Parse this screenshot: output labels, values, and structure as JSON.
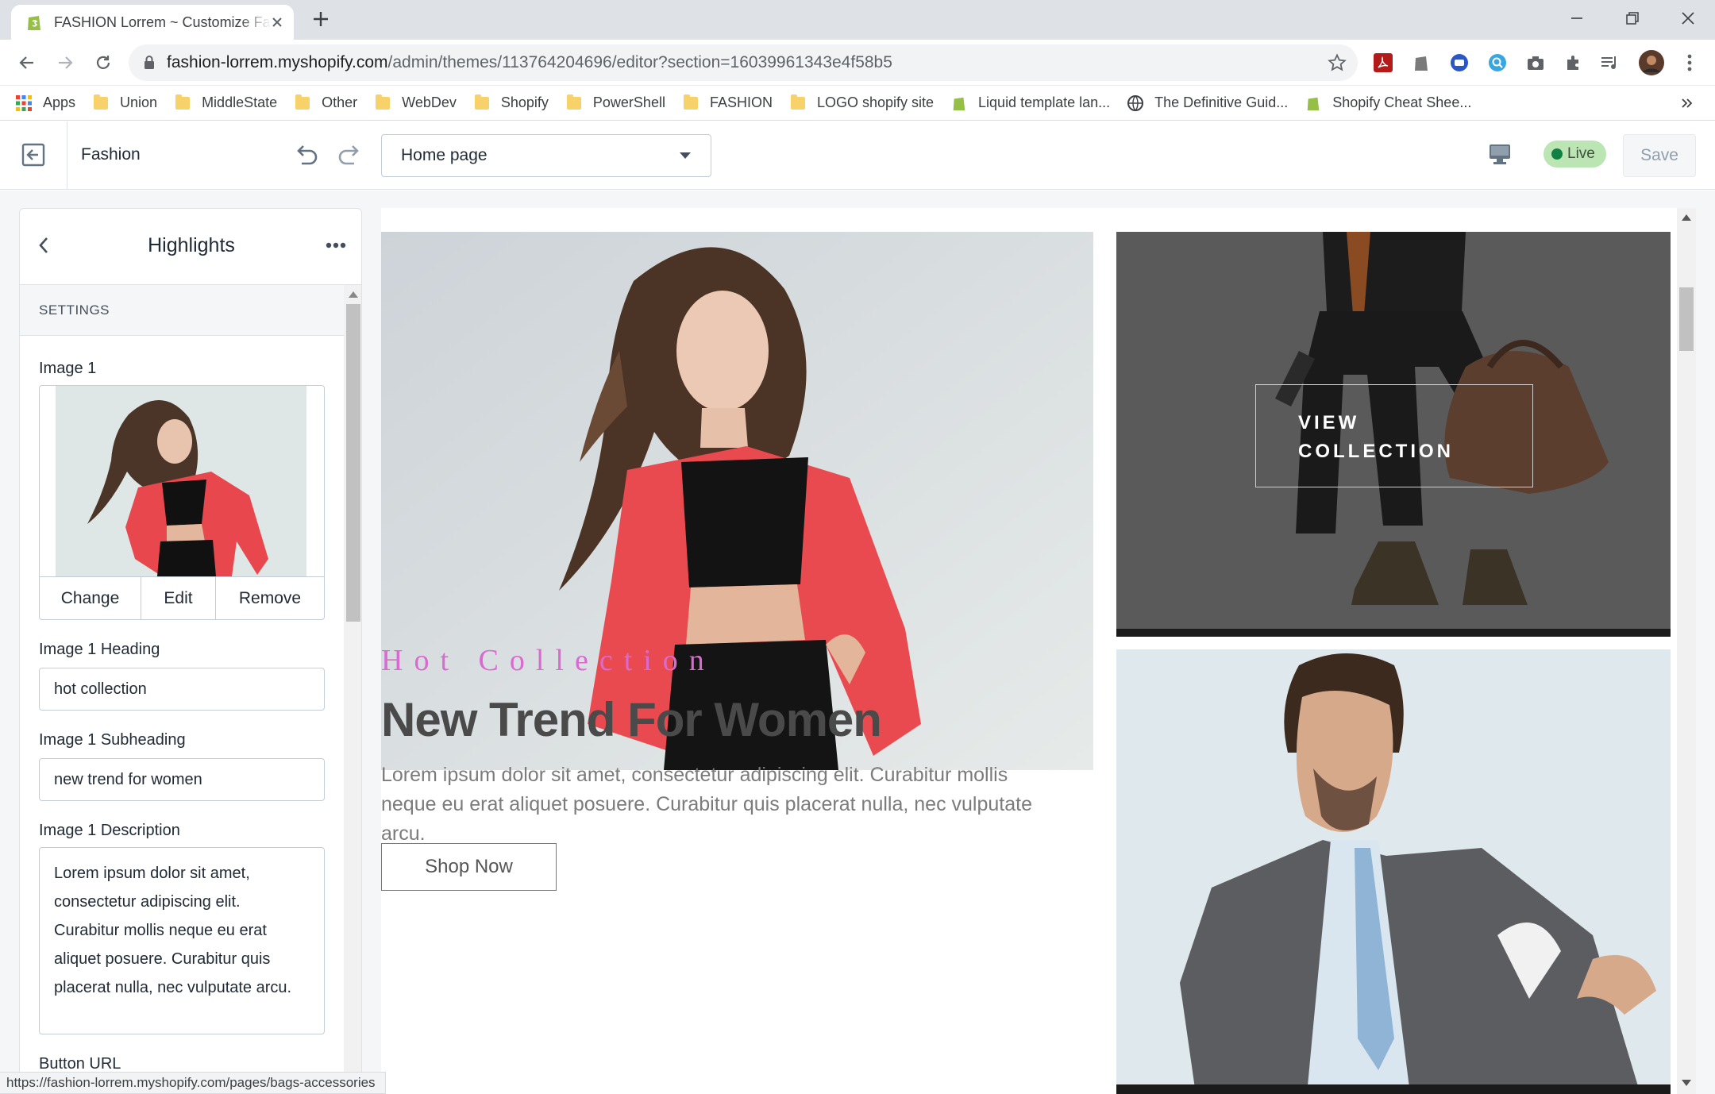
{
  "browser": {
    "tab_title": "FASHION Lorrem ~ Customize Fashion",
    "url_host": "fashion-lorrem.myshopify.com",
    "url_path": "/admin/themes/113764204696/editor?section=16039961343e4f58b5",
    "bookmarks": [
      {
        "label": "Apps",
        "icon": "apps-grid-icon"
      },
      {
        "label": "Union",
        "icon": "folder-icon"
      },
      {
        "label": "MiddleState",
        "icon": "folder-icon"
      },
      {
        "label": "Other",
        "icon": "folder-icon"
      },
      {
        "label": "WebDev",
        "icon": "folder-icon"
      },
      {
        "label": "Shopify",
        "icon": "folder-icon"
      },
      {
        "label": "PowerShell",
        "icon": "folder-icon"
      },
      {
        "label": "FASHION",
        "icon": "folder-icon"
      },
      {
        "label": "LOGO shopify site",
        "icon": "folder-icon"
      },
      {
        "label": "Liquid template lan...",
        "icon": "shopify-icon"
      },
      {
        "label": "The Definitive Guid...",
        "icon": "globe-icon"
      },
      {
        "label": "Shopify Cheat Shee...",
        "icon": "shopify-icon"
      }
    ],
    "status_url": "https://fashion-lorrem.myshopify.com/pages/bags-accessories"
  },
  "editor": {
    "theme_name": "Fashion",
    "template_select": "Home page",
    "live_label": "Live",
    "save_label": "Save"
  },
  "sidebar": {
    "title": "Highlights",
    "settings_label": "SETTINGS",
    "image_label": "Image 1",
    "image_actions": [
      "Change",
      "Edit",
      "Remove"
    ],
    "heading_label": "Image 1 Heading",
    "heading_value": "hot collection",
    "subheading_label": "Image 1 Subheading",
    "subheading_value": "new trend for women",
    "description_label": "Image 1 Description",
    "description_lines": [
      "Lorem ipsum dolor sit amet,",
      "consectetur adipiscing elit.",
      "Curabitur mollis neque eu erat",
      "aliquet posuere. Curabitur quis",
      "placerat nulla, nec vulputate arcu."
    ],
    "button_url_label": "Button URL"
  },
  "preview": {
    "hot_collection": "Hot Collection",
    "headline": "New Trend For Women",
    "body": "Lorem ipsum dolor sit amet, consectetur adipiscing elit. Curabitur mollis neque eu erat aliquet posuere. Curabitur quis placerat nulla, nec vulputate arcu.",
    "shop_now": "Shop Now",
    "view_collection_line1": "VIEW",
    "view_collection_line2": "COLLECTION"
  },
  "colors": {
    "accent_pink": "#d96ad0",
    "live_green": "#108043",
    "headline": "#4a4a4a"
  }
}
